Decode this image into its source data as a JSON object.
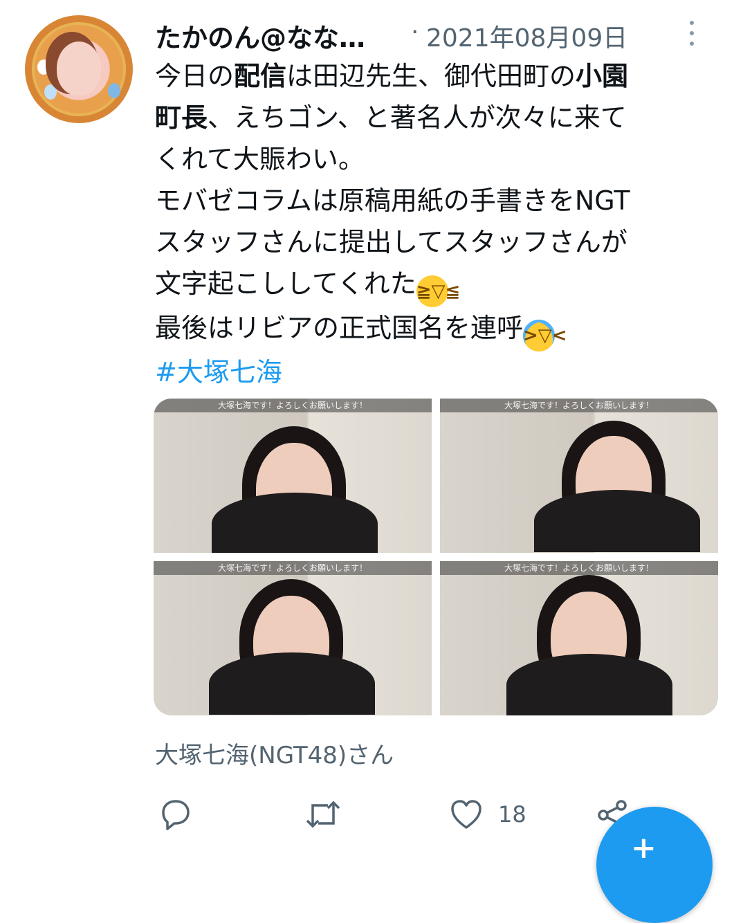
{
  "tweet": {
    "author": "たかのん@なな…",
    "separator": "·",
    "date": "2021年08月09日",
    "lines": [
      {
        "plain_a": "今日の",
        "bold_a": "配信",
        "plain_b": "は田辺先生、御代田町の",
        "bold_b": "小園"
      },
      {
        "bold_a": "町長",
        "plain_b": "、えちゴン、と著名人が次々に来て"
      },
      {
        "plain_a": "くれて大賑わい。"
      },
      {
        "plain_a": "モバゼコラムは原稿用紙の手書きをNGT"
      },
      {
        "plain_a": "スタッフさんに提出してスタッフさんが"
      },
      {
        "plain_a": "文字起こししてくれた"
      },
      {
        "plain_a": "最後はリビアの正式国名を連呼"
      }
    ],
    "emoji_1": "grinning-squinting-face",
    "emoji_2": "face-with-tears-of-joy",
    "hashtag": "#大塚七海",
    "media": [
      {
        "caption": "大塚七海です！よろしくお願いします！"
      },
      {
        "caption": "大塚七海です！よろしくお願いします！"
      },
      {
        "caption": "大塚七海です！よろしくお願いします！"
      },
      {
        "caption": "大塚七海です！よろしくお願いします！"
      }
    ],
    "credit": "大塚七海(NGT48)さん",
    "actions": {
      "reply_icon": "reply-icon",
      "retweet_icon": "retweet-icon",
      "like_icon": "heart-icon",
      "like_count": "18",
      "share_icon": "share-icon"
    }
  },
  "fab": {
    "icon": "compose-icon"
  },
  "colors": {
    "accent": "#1d9bf0",
    "text": "#0f1419",
    "muted": "#536471"
  }
}
